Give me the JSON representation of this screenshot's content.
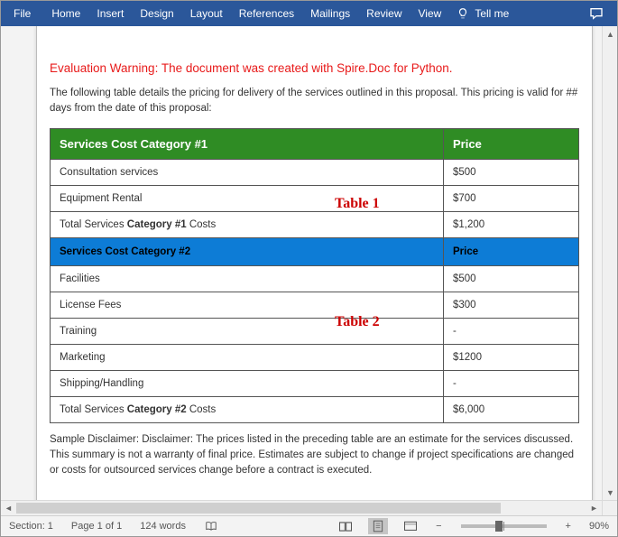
{
  "ribbon": {
    "tabs": [
      "File",
      "Home",
      "Insert",
      "Design",
      "Layout",
      "References",
      "Mailings",
      "Review",
      "View"
    ],
    "tellme": "Tell me"
  },
  "document": {
    "warning": "Evaluation Warning: The document was created with Spire.Doc for Python.",
    "intro": "The following table details the pricing for delivery of the services outlined in this proposal. This pricing is valid for ## days from the date of this proposal:",
    "table1_label": "Table 1",
    "table2_label": "Table 2",
    "headers1": {
      "a": "Services Cost Category #1",
      "b": "Price"
    },
    "headers2": {
      "a": "Services Cost Category #2",
      "b": "Price"
    },
    "rows1": {
      "r0": {
        "a": "Consultation services",
        "b": "$500"
      },
      "r1": {
        "a": "Equipment Rental",
        "b": "$700"
      },
      "r2": {
        "a1": "Total Services",
        "a2": " Category #1",
        "a3": " Costs",
        "b": "$1,200"
      }
    },
    "rows2": {
      "r0": {
        "a": "Facilities",
        "b": "$500"
      },
      "r1": {
        "a": "License Fees",
        "b": "$300"
      },
      "r2": {
        "a": "Training",
        "b": "-"
      },
      "r3": {
        "a": "Marketing",
        "b": "$1200"
      },
      "r4": {
        "a": "Shipping/Handling",
        "b": "-"
      },
      "r5": {
        "a1": "Total Services",
        "a2": " Category #2",
        "a3": " Costs",
        "b": "$6,000"
      }
    },
    "disclaimer": "Sample Disclaimer: Disclaimer: The prices listed in the preceding table are an estimate for the services discussed. This summary is not a warranty of final price. Estimates are subject to change if project specifications are changed or costs for outsourced services change before a contract is executed."
  },
  "status": {
    "section": "Section: 1",
    "page": "Page 1 of 1",
    "words": "124 words",
    "zoom": "90%",
    "minus": "−",
    "plus": "+"
  }
}
